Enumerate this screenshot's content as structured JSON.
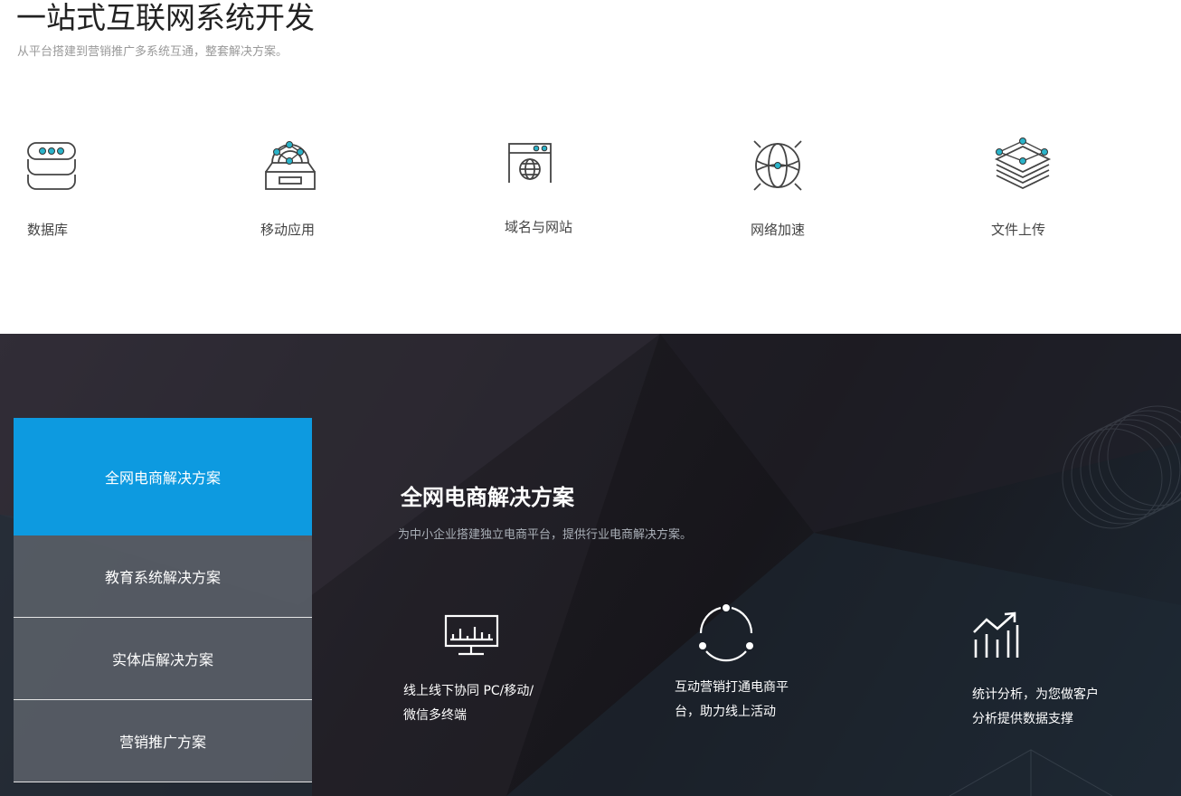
{
  "header": {
    "title": "一站式互联网系统开发",
    "subtitle": "从平台搭建到营销推广多系统互通，整套解决方案。"
  },
  "services": [
    {
      "label": "数据库",
      "icon": "database-icon"
    },
    {
      "label": "移动应用",
      "icon": "mobile-app-icon"
    },
    {
      "label": "域名与网站",
      "icon": "domain-website-icon"
    },
    {
      "label": "网络加速",
      "icon": "globe-acceleration-icon"
    },
    {
      "label": "文件上传",
      "icon": "layers-upload-icon"
    }
  ],
  "solutions": {
    "tabs": [
      {
        "label": "全网电商解决方案",
        "active": true
      },
      {
        "label": "教育系统解决方案",
        "active": false
      },
      {
        "label": "实体店解决方案",
        "active": false
      },
      {
        "label": "营销推广方案",
        "active": false
      }
    ],
    "panel": {
      "title": "全网电商解决方案",
      "subtitle": "为中小企业搭建独立电商平台，提供行业电商解决方案。",
      "features": [
        {
          "icon": "monitor-chart-icon",
          "line1": "线上线下协同 PC/移动/",
          "line2": "微信多终端"
        },
        {
          "icon": "cycle-dots-icon",
          "line1": "互动营销打通电商平",
          "line2": "台，助力线上活动"
        },
        {
          "icon": "growth-chart-icon",
          "line1": "统计分析，为您做客户",
          "line2": "分析提供数据支撑"
        }
      ]
    }
  },
  "colors": {
    "accent": "#0d9ae0",
    "icon_dot": "#2ab3c9",
    "dark_bg": "#1c1a20"
  }
}
